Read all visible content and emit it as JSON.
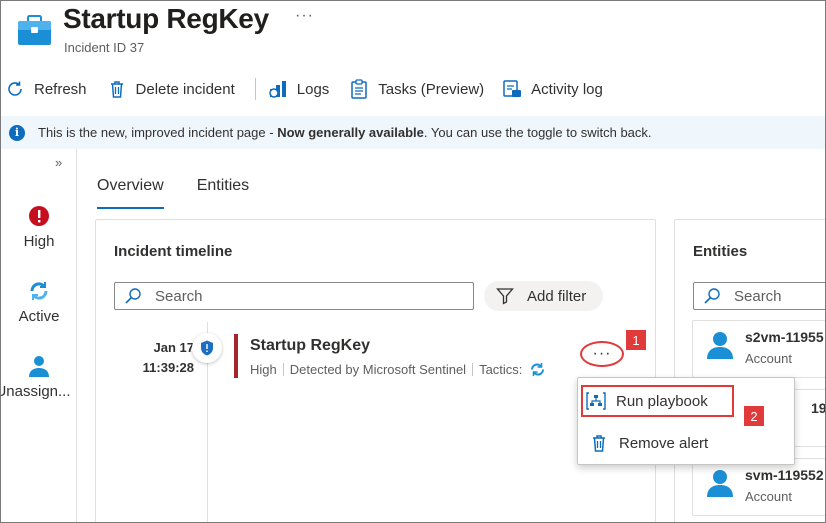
{
  "header": {
    "title": "Startup RegKey",
    "subtitle": "Incident ID 37",
    "more": "···"
  },
  "toolbar": {
    "refresh": "Refresh",
    "delete": "Delete incident",
    "logs": "Logs",
    "tasks": "Tasks (Preview)",
    "activity": "Activity log"
  },
  "banner": {
    "icon": "i",
    "text_before": "This is the new, improved incident page - ",
    "text_bold": "Now generally available",
    "text_after": ". You can use the toggle to switch back."
  },
  "rail": {
    "collapse": "»",
    "severity": "High",
    "status": "Active",
    "owner": "Unassign..."
  },
  "tabs": {
    "overview": "Overview",
    "entities": "Entities"
  },
  "timeline": {
    "title": "Incident timeline",
    "search_placeholder": "Search",
    "add_filter": "Add filter",
    "item": {
      "date": "Jan 17",
      "time": "11:39:28",
      "title": "Startup RegKey",
      "severity": "High",
      "source": "Detected by Microsoft Sentinel",
      "tactics_label": "Tactics:",
      "more": "···"
    }
  },
  "entities_panel": {
    "title": "Entities",
    "search_placeholder": "Search",
    "items": [
      {
        "name": "s2vm-11955",
        "type": "Account"
      },
      {
        "name": "",
        "type": ""
      },
      {
        "name": "svm-119552",
        "type": "Account"
      }
    ],
    "partial_name": "1955"
  },
  "context_menu": {
    "run_playbook": "Run playbook",
    "remove_alert": "Remove alert"
  },
  "steps": {
    "one": "1",
    "two": "2"
  },
  "colors": {
    "accent": "#0f6cbd",
    "severity_high": "#a4262c",
    "annotation": "#e03a3a",
    "banner_bg": "#eff6fc"
  }
}
